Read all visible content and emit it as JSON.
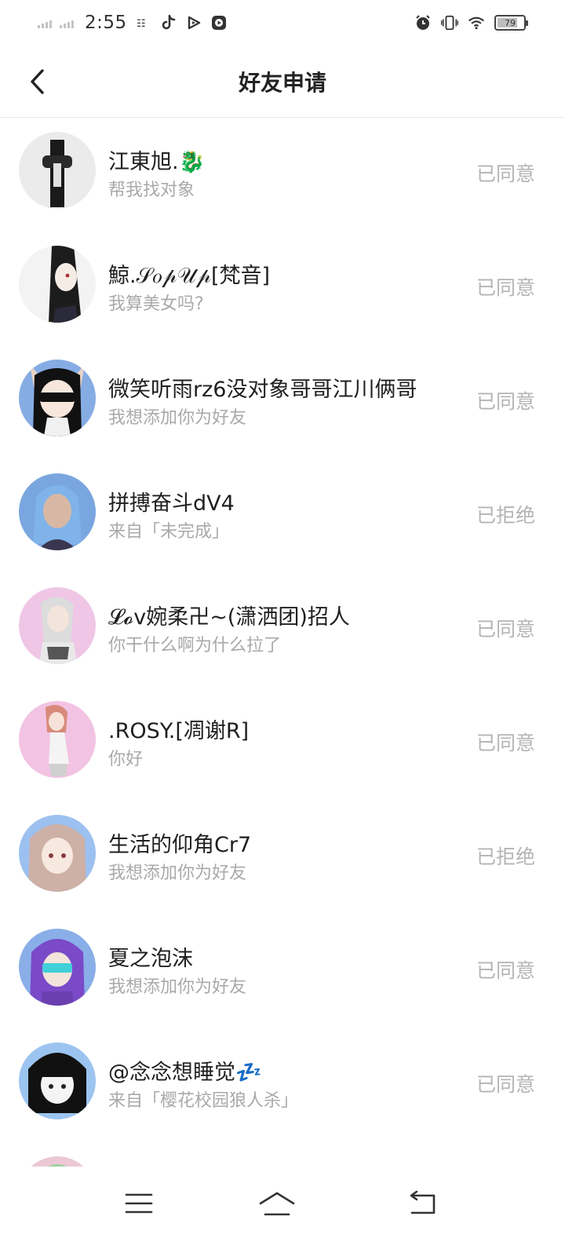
{
  "status_bar": {
    "time": "2:55",
    "battery": 79,
    "icons": [
      "signal-icon",
      "signal-icon",
      "carrier-icon",
      "tiktok-icon",
      "play-icon",
      "video-icon",
      "alarm-icon",
      "vibrate-icon",
      "wifi-icon",
      "battery-icon"
    ]
  },
  "header": {
    "title": "好友申请",
    "back_icon": "chevron-left-icon"
  },
  "requests": [
    {
      "name": "江東旭.🐉",
      "message": "帮我找对象",
      "status": "已同意",
      "avatar_color": "#e8e8e8"
    },
    {
      "name": "鯨.𝒮𝑜𝓅𝒰𝓅[梵音]",
      "message": "我算美女吗?",
      "status": "已同意",
      "avatar_color": "#f2f2f2"
    },
    {
      "name": "微笑听雨rz6没对象哥哥江川俩哥",
      "message": "我想添加你为好友",
      "status": "已同意",
      "avatar_color": "#8fb4e8"
    },
    {
      "name": "拼搏奋斗dV4",
      "message": "来自「未完成」",
      "status": "已拒绝",
      "avatar_color": "#7aa8e0"
    },
    {
      "name": "𝓛𝓸v婉柔卍~(潇洒团)招人",
      "message": "你干什么啊为什么拉了",
      "status": "已同意",
      "avatar_color": "#f0c8e8"
    },
    {
      "name": ".ROSY.[凋谢R]",
      "message": "你好",
      "status": "已同意",
      "avatar_color": "#f3c5e4"
    },
    {
      "name": "生活的仰角Cr7",
      "message": "我想添加你为好友",
      "status": "已拒绝",
      "avatar_color": "#9ec2f0"
    },
    {
      "name": "夏之泡沫",
      "message": "我想添加你为好友",
      "status": "已同意",
      "avatar_color": "#8db0ea"
    },
    {
      "name": "@念念想睡觉💤",
      "message": "来自「樱花校园狼人杀」",
      "status": "已同意",
      "avatar_color": "#9ec6f2"
    },
    {
      "name": "",
      "message": "",
      "status": "",
      "avatar_color": "#e8c8d8"
    }
  ],
  "nav": {
    "menu_icon": "menu-icon",
    "home_icon": "home-icon",
    "back_icon": "back-icon"
  }
}
